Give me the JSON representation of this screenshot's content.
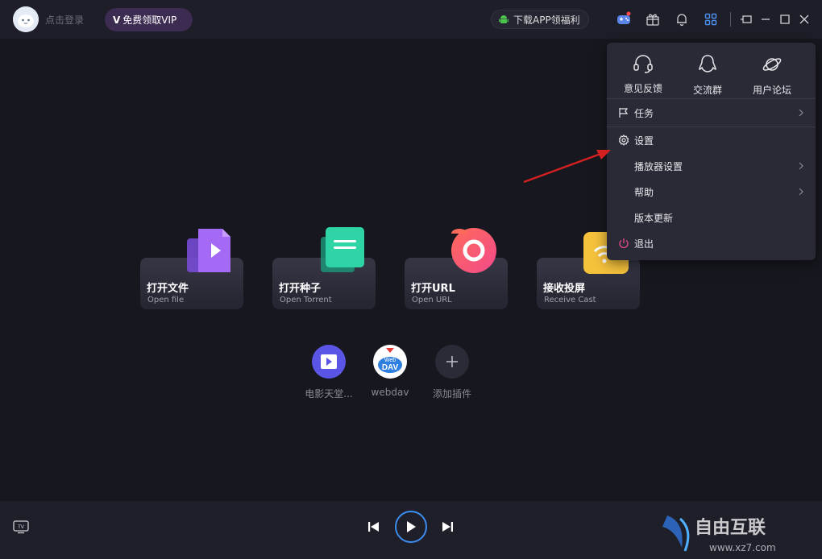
{
  "titlebar": {
    "login_label": "点击登录",
    "vip_prefix": "V",
    "vip_label": "免费领取VIP",
    "app_download_label": "下载APP领福利"
  },
  "cards": [
    {
      "title": "打开文件",
      "subtitle": "Open file",
      "icon": "file-play-icon"
    },
    {
      "title": "打开种子",
      "subtitle": "Open Torrent",
      "icon": "torrent-doc-icon"
    },
    {
      "title": "打开URL",
      "subtitle": "Open URL",
      "icon": "url-ring-icon"
    },
    {
      "title": "接收投屏",
      "subtitle": "Receive Cast",
      "icon": "cast-wifi-icon"
    }
  ],
  "plugins": [
    {
      "label": "电影天堂...",
      "icon": "movie-play-icon"
    },
    {
      "label": "webdav",
      "icon": "webdav-cloud-icon",
      "badge": "Web",
      "badge2": "DAV"
    },
    {
      "label": "添加插件",
      "icon": "plus-icon"
    }
  ],
  "menu": {
    "top_items": [
      {
        "label": "意见反馈",
        "icon": "headset-icon"
      },
      {
        "label": "交流群",
        "icon": "qq-penguin-icon"
      },
      {
        "label": "用户论坛",
        "icon": "planet-icon"
      }
    ],
    "rows": {
      "tasks": "任务",
      "settings": "设置",
      "player_settings": "播放器设置",
      "help": "帮助",
      "update": "版本更新",
      "quit": "退出"
    }
  },
  "watermark": {
    "text": "自由互联",
    "url": "www.xz7.com"
  },
  "colors": {
    "accent": "#3c8cf0",
    "annotation_arrow": "#d42020",
    "vip_bg": "#3d2c52"
  }
}
